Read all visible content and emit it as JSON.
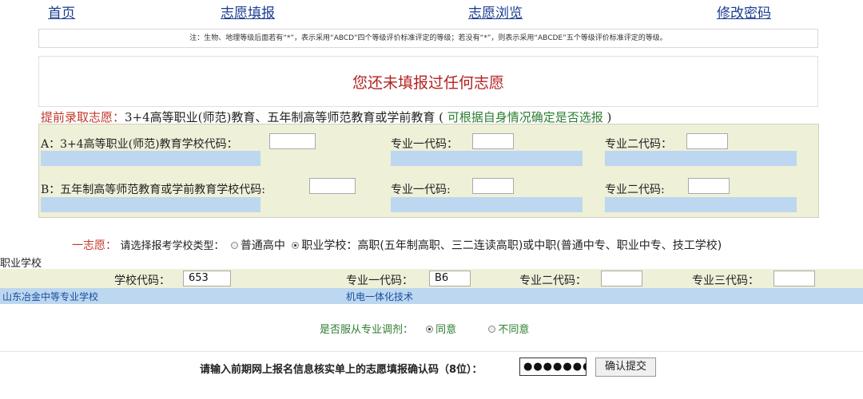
{
  "nav": {
    "home": "首页",
    "fill": "志愿填报",
    "browse": "志愿浏览",
    "password": "修改密码"
  },
  "note": "注：生物、地理等级后面若有“*”，表示采用“ABCD”四个等级评价标准评定的等级；若没有“*”，则表示采用“ABCDE”五个等级评价标准评定的等级。",
  "message": "您还未填报过任何志愿",
  "early": {
    "title_red": "提前录取志愿：",
    "title_black": "3+4高等职业(师范)教育、五年制高等师范教育或学前教育 ( ",
    "title_green": "可根据自身情况确定是否选报",
    "title_end": " )",
    "row_a": {
      "school_label": "A：3+4高等职业(师范)教育学校代码：",
      "school_code": "",
      "major1_label": "专业一代码：",
      "major1_code": "",
      "major2_label": "专业二代码：",
      "major2_code": ""
    },
    "row_b": {
      "school_label": "B：五年制高等师范教育或学前教育学校代码:",
      "school_code": "",
      "major1_label": "专业一代码:",
      "major1_code": "",
      "major2_label": "专业二代码:",
      "major2_code": ""
    }
  },
  "first": {
    "label": "一志愿：",
    "prompt": "请选择报考学校类型：",
    "option1": "普通高中",
    "option2": "职业学校：高职(五年制高职、三二连读高职)或中职(普通中专、职业中专、技工学校)",
    "selected": "职业学校"
  },
  "vocational": {
    "section_label": "职业学校",
    "school_code_label": "学校代码：",
    "school_code": "653",
    "major1_label": "专业一代码：",
    "major1_code": "B6",
    "major2_label": "专业二代码：",
    "major2_code": "",
    "major3_label": "专业三代码：",
    "major3_code": "",
    "school_name": "山东冶金中等专业学校",
    "major1_name": "机电一体化技术"
  },
  "adjust": {
    "prompt": "是否服从专业调剂：",
    "agree": "同意",
    "disagree": "不同意",
    "selected": "同意"
  },
  "confirm": {
    "label": "请输入前期网上报名信息核实单上的志愿填报确认码（8位）：",
    "value": "●●●●●●●●",
    "submit": "确认提交"
  }
}
